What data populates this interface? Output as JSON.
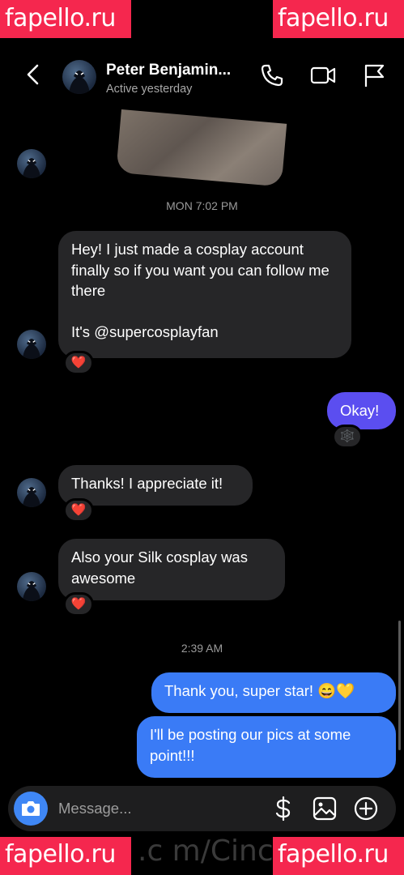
{
  "watermark": {
    "text": "fapello.ru",
    "bottom_text": ".c m/Cinc"
  },
  "header": {
    "name": "Peter Benjamin...",
    "status": "Active yesterday",
    "back_icon": "chevron-left-icon",
    "call_icon": "phone-icon",
    "video_icon": "video-camera-icon",
    "report_icon": "flag-icon"
  },
  "thread": {
    "timestamp1": "MON 7:02 PM",
    "msg1": "Hey! I just made a cosplay account finally so if you want you can follow me there\n\nIt's @supercosplayfan",
    "msg2": "Okay!",
    "msg3": "Thanks! I appreciate it!",
    "msg4": "Also your Silk cosplay was awesome",
    "timestamp2": "2:39 AM",
    "msg5": "Thank you, super star! 😄💛",
    "msg6": "I'll be posting our pics at some point!!!",
    "reaction_heart": "❤️",
    "reaction_web": "🕸️"
  },
  "composer": {
    "placeholder": "Message...",
    "camera_icon": "camera-icon",
    "payment_icon": "dollar-icon",
    "gallery_icon": "image-icon",
    "add_icon": "plus-circle-icon"
  },
  "colors": {
    "incoming": "#262628",
    "outgoing": "#3a7bf6",
    "outgoing_alt": "#5b4ef0",
    "accent": "#3f87f5"
  }
}
